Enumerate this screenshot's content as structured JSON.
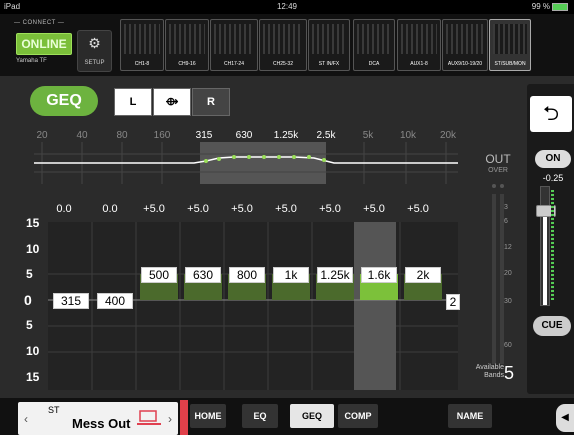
{
  "status": {
    "left": "iPad",
    "time": "12:49",
    "battery": "99 %"
  },
  "connect": {
    "label": "CONNECT",
    "online": "ONLINE",
    "device": "Yamaha TF",
    "setup": "SETUP"
  },
  "banks": [
    "CH1-8",
    "CH9-16",
    "CH17-24",
    "CH25-32",
    "ST IN/FX",
    "DCA",
    "AUX1-8",
    "AUX9/10-19/20",
    "ST/SUB/MON"
  ],
  "geq": {
    "label": "GEQ",
    "l": "L",
    "link": "⟴",
    "r": "R"
  },
  "freq_labels": [
    "20",
    "40",
    "80",
    "160",
    "315",
    "630",
    "1.25k",
    "2.5k",
    "5k",
    "10k",
    "20k"
  ],
  "gain_values": [
    "0.0",
    "0.0",
    "+5.0",
    "+5.0",
    "+5.0",
    "+5.0",
    "+5.0",
    "+5.0",
    "+5.0"
  ],
  "db_scale": [
    "15",
    "10",
    "5",
    "0",
    "5",
    "10",
    "15"
  ],
  "bands": [
    {
      "label": "315",
      "gain": 0
    },
    {
      "label": "400",
      "gain": 0
    },
    {
      "label": "500",
      "gain": 5
    },
    {
      "label": "630",
      "gain": 5
    },
    {
      "label": "800",
      "gain": 5
    },
    {
      "label": "1k",
      "gain": 5
    },
    {
      "label": "1.25k",
      "gain": 5
    },
    {
      "label": "1.6k",
      "gain": 5
    },
    {
      "label": "2k",
      "gain": 5
    }
  ],
  "edge_label": "2",
  "out": {
    "label": "OUT",
    "over": "OVER",
    "scale": [
      "3",
      "6",
      "12",
      "20",
      "30",
      "60"
    ]
  },
  "available": {
    "label_line1": "Available",
    "label_line2": "Bands",
    "count": "5"
  },
  "right": {
    "back": "⮌",
    "on": "ON",
    "value": "-0.25",
    "cue": "CUE"
  },
  "channel": {
    "type": "ST",
    "name": "Mess Out"
  },
  "tabs": [
    "HOME",
    "EQ",
    "GEQ",
    "COMP",
    "NAME"
  ],
  "colors": {
    "accent": "#6db33f",
    "online": "#7bbf3a",
    "selected_band": "#7cc13a"
  }
}
